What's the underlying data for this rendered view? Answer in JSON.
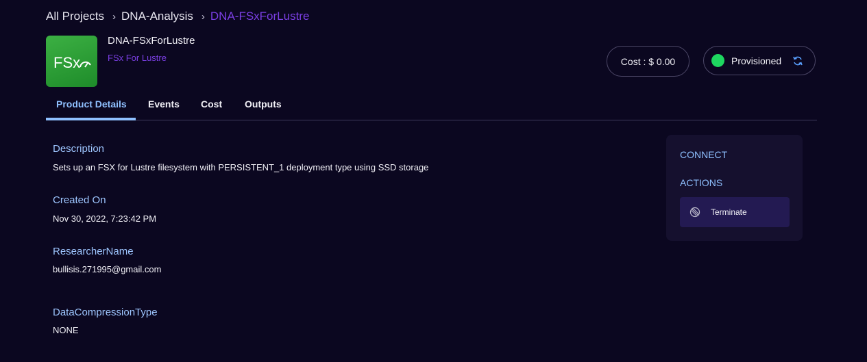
{
  "breadcrumb": {
    "items": [
      "All Projects",
      "DNA-Analysis",
      "DNA-FSxForLustre"
    ],
    "separator": "›"
  },
  "product": {
    "logo_text": "FSx",
    "name": "DNA-FSxForLustre",
    "type": "FSx For Lustre"
  },
  "header": {
    "cost_label": "Cost : $ 0.00",
    "status_label": "Provisioned",
    "status_color": "#1ed760"
  },
  "tabs": [
    {
      "label": "Product Details",
      "active": true
    },
    {
      "label": "Events",
      "active": false
    },
    {
      "label": "Cost",
      "active": false
    },
    {
      "label": "Outputs",
      "active": false
    }
  ],
  "details": [
    {
      "label": "Description",
      "value": "Sets up an FSX for Lustre filesystem with PERSISTENT_1 deployment type using SSD storage"
    },
    {
      "label": "Created On",
      "value": "Nov 30, 2022, 7:23:42 PM"
    },
    {
      "label": "ResearcherName",
      "value": "bullisis.271995@gmail.com"
    },
    {
      "label": "DataCompressionType",
      "value": "NONE"
    }
  ],
  "side_panel": {
    "connect_heading": "CONNECT",
    "actions_heading": "ACTIONS",
    "terminate_label": "Terminate"
  },
  "colors": {
    "background": "#0b0720",
    "accent_purple": "#7b3fe4",
    "accent_blue": "#8fc0ff",
    "logo_green": "#2ca33a"
  },
  "icons": {
    "refresh": "refresh-icon",
    "terminate": "ban-icon",
    "logo": "fsx-logo-icon"
  }
}
